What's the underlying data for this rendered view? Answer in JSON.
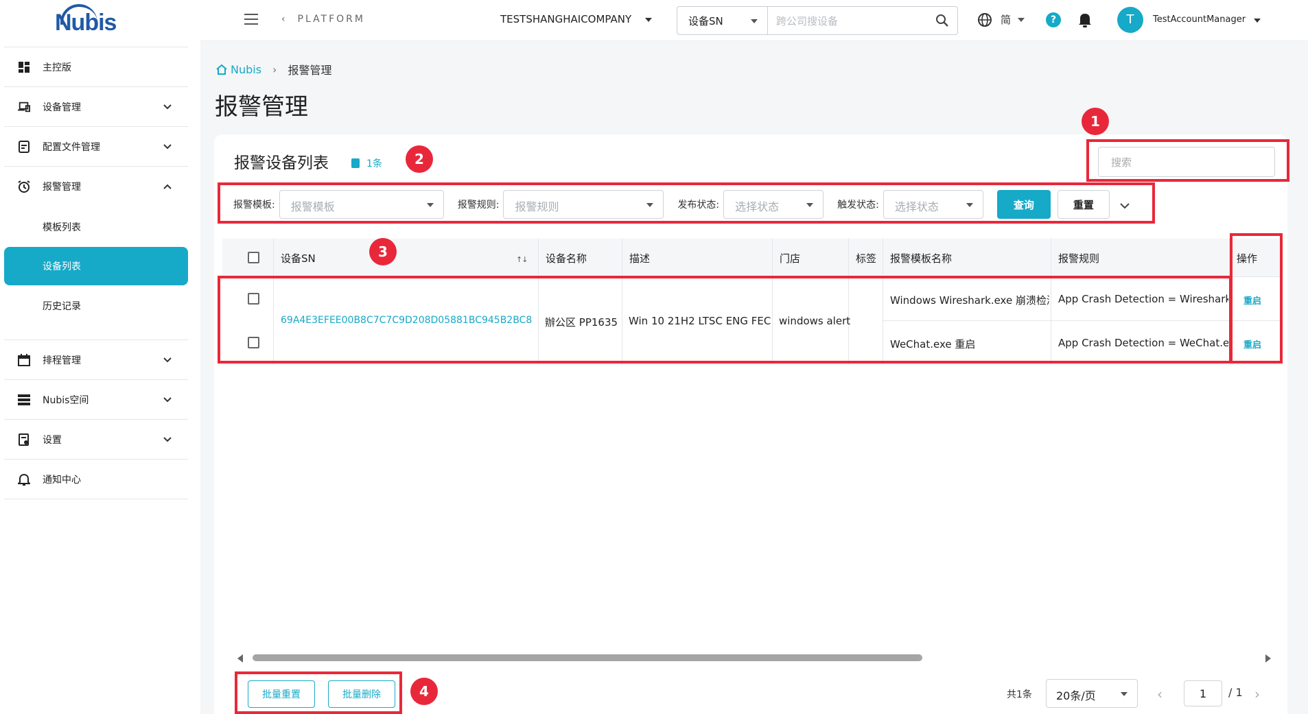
{
  "app": {
    "brand": "Nubis",
    "platform_label": "PLATFORM"
  },
  "sidebar": {
    "items": [
      {
        "label": "主控版",
        "icon": "dashboard-icon"
      },
      {
        "label": "设备管理",
        "icon": "devices-icon"
      },
      {
        "label": "配置文件管理",
        "icon": "profile-icon"
      },
      {
        "label": "报警管理",
        "icon": "alarm-clock-icon"
      },
      {
        "label": "排程管理",
        "icon": "calendar-icon"
      },
      {
        "label": "Nubis空间",
        "icon": "storage-icon"
      },
      {
        "label": "设置",
        "icon": "settings-doc-icon"
      },
      {
        "label": "通知中心",
        "icon": "bell-icon"
      }
    ],
    "alarm_sub": [
      {
        "label": "模板列表"
      },
      {
        "label": "设备列表",
        "active": true
      },
      {
        "label": "历史记录"
      }
    ]
  },
  "topbar": {
    "company": "TESTSHANGHAICOMPANY",
    "search_type": "设备SN",
    "search_placeholder": "跨公司搜设备",
    "language": "简",
    "help": "?",
    "avatar_initial": "T",
    "username": "TestAccountManager"
  },
  "breadcrumb": {
    "home": "Nubis",
    "current": "报警管理"
  },
  "page_title": "报警管理",
  "card": {
    "title": "报警设备列表",
    "count_label": "1条",
    "search_placeholder": "搜索"
  },
  "filters": {
    "template_label": "报警模板:",
    "template_placeholder": "报警模板",
    "rule_label": "报警规则:",
    "rule_placeholder": "报警规则",
    "publish_label": "发布状态:",
    "publish_placeholder": "选择状态",
    "trigger_label": "触发状态:",
    "trigger_placeholder": "选择状态",
    "query_button": "查询",
    "reset_button": "重置"
  },
  "table": {
    "columns": [
      "设备SN",
      "设备名称",
      "描述",
      "门店",
      "标签",
      "报警模板名称",
      "报警规则",
      "操作"
    ],
    "sort_indicator": "↑↓",
    "device": {
      "sn": "69A4E3EFEE00B8C7C7C9D208D05881BC945B2BC8",
      "name": "辦公区 PP1635",
      "description": "Win 10 21H2 LTSC ENG FEC",
      "store": "windows alert",
      "tag": ""
    },
    "rules": [
      {
        "template_name": "Windows Wireshark.exe 崩溃检测",
        "rule": "App Crash Detection = Wireshark.exe",
        "action": "重启"
      },
      {
        "template_name": "WeChat.exe 重启",
        "rule": "App Crash Detection = WeChat.exe",
        "action": "重启"
      }
    ]
  },
  "footer": {
    "batch_reset": "批量重置",
    "batch_delete": "批量删除",
    "total": "共1条",
    "page_size": "20条/页",
    "current_page": "1",
    "total_pages": "/ 1"
  },
  "annotations": {
    "markers": [
      "1",
      "2",
      "3",
      "4"
    ],
    "color": "#e8283a"
  },
  "colors": {
    "accent": "#17a9c8",
    "brand": "#1f5aa6"
  }
}
